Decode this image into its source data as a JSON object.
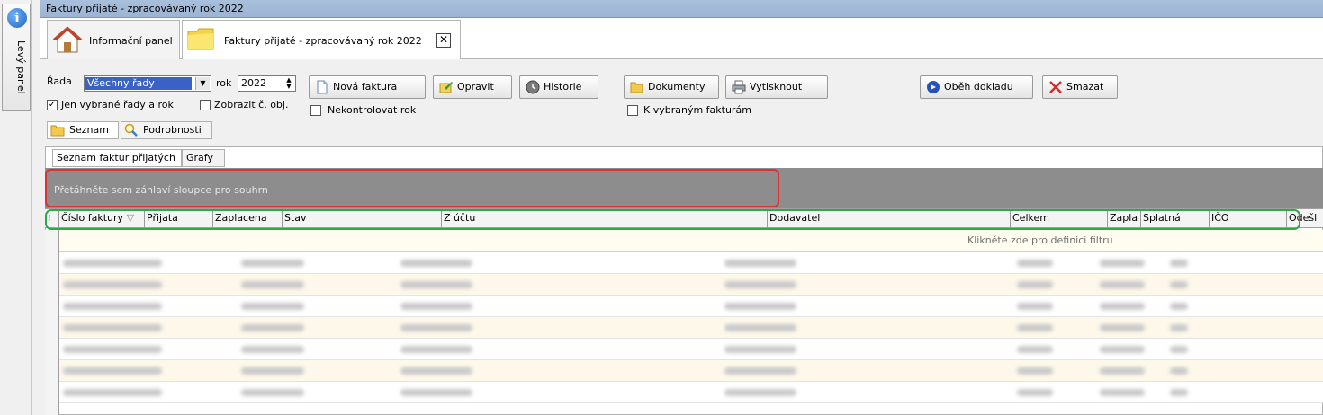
{
  "left_panel": {
    "label": "Levý panel"
  },
  "window": {
    "title": "Faktury přijaté - zpracovávaný rok 2022"
  },
  "tabs": [
    {
      "label": "Informační panel"
    },
    {
      "label": "Faktury přijaté - zpracovávaný rok 2022"
    }
  ],
  "toolbar": {
    "series_label": "Řada",
    "series_value": "Všechny řady",
    "year_label": "rok",
    "year_value": "2022",
    "only_selected_label": "Jen vybrané řady a rok",
    "only_selected_checked": true,
    "show_order_label": "Zobrazit č. obj.",
    "new_invoice": "Nová faktura",
    "edit": "Opravit",
    "history": "Historie",
    "no_check_year": "Nekontrolovat rok",
    "documents": "Dokumenty",
    "to_selected_invoices": "K vybraným fakturám",
    "print": "Vytisknout",
    "circulation": "Oběh dokladu",
    "delete": "Smazat"
  },
  "view_tabs": [
    {
      "label": "Seznam"
    },
    {
      "label": "Podrobnosti"
    }
  ],
  "list_tabs": [
    {
      "label": "Seznam faktur přijatých"
    },
    {
      "label": "Grafy"
    }
  ],
  "grid": {
    "group_hint": "Přetáhněte sem záhlaví sloupce pro souhrn",
    "columns": [
      "Číslo faktury",
      "Přijata",
      "Zaplacena",
      "Stav",
      "Z účtu",
      "Dodavatel",
      "Celkem",
      "Zapla",
      "Splatná",
      "IČO",
      "Odešl"
    ],
    "filter_hint": "Klikněte zde pro definici filtru",
    "row_count": 8
  },
  "colors": {
    "accent": "#3a62c4",
    "red_highlight": "#e03030",
    "green_highlight": "#2fa84a",
    "group_panel": "#8d8d8d"
  }
}
